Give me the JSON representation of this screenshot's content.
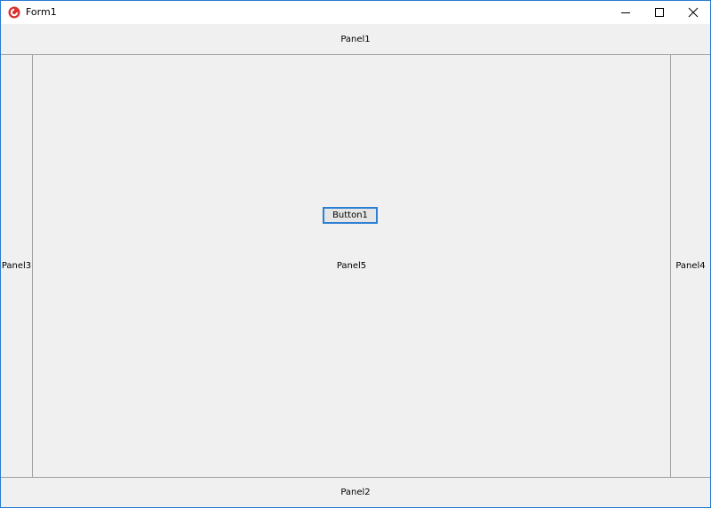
{
  "window": {
    "title": "Form1",
    "accent_color": "#2a7bd0",
    "app_icon": "delphi-app-icon",
    "controls": {
      "minimize_icon": "minimize-icon",
      "maximize_icon": "maximize-icon",
      "close_icon": "close-icon"
    }
  },
  "panels": {
    "top": "Panel1",
    "bottom": "Panel2",
    "left": "Panel3",
    "right": "Panel4",
    "center": "Panel5"
  },
  "button": {
    "label": "Button1"
  }
}
